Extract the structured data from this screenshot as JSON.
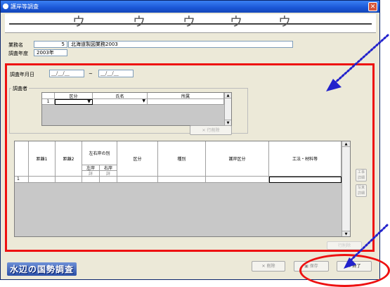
{
  "window": {
    "title": "護岸等調査",
    "close_label": "✕"
  },
  "ringbar": {
    "glyphs": [
      "ウ",
      "ウ",
      "ウ",
      "ウ",
      "ウ",
      "ウ"
    ]
  },
  "info": {
    "project_label": "業務名",
    "project_number": "5",
    "project_name": "北海道製図業務2003",
    "year_label": "調査年度",
    "year_value": "2003年"
  },
  "survey_date": {
    "label": "調査年月日",
    "from": "__/__/__",
    "separator": "~",
    "to": "__/__/__"
  },
  "surveyor": {
    "label": "調査者",
    "columns": [
      "区分",
      "氏名",
      "所属"
    ],
    "rows": [
      {
        "no": "1",
        "kubun": "",
        "name": "",
        "shozoku": ""
      }
    ],
    "delete_row_label": "行削除"
  },
  "main_grid": {
    "headers": [
      "距離1",
      "距離2",
      "左右岸の別",
      "区分",
      "種別",
      "護岸区分",
      "工法・材料等"
    ],
    "sub_headers": [
      "左岸",
      "右岸"
    ],
    "sub_values": [
      "詳",
      "詳"
    ],
    "rows": [
      {
        "no": "1"
      }
    ]
  },
  "side_buttons": [
    {
      "label": "工事 詳細"
    },
    {
      "label": "写真 詳細"
    }
  ],
  "bottom": {
    "brand": "水辺の国勢調査",
    "faint_button": "行削除",
    "delete_label": "削除",
    "save_label": "保存",
    "exit_label": "終了"
  },
  "colors": {
    "highlight": "#ee1111",
    "annotation": "#2222cc",
    "title_bar": "#1a56d6"
  }
}
